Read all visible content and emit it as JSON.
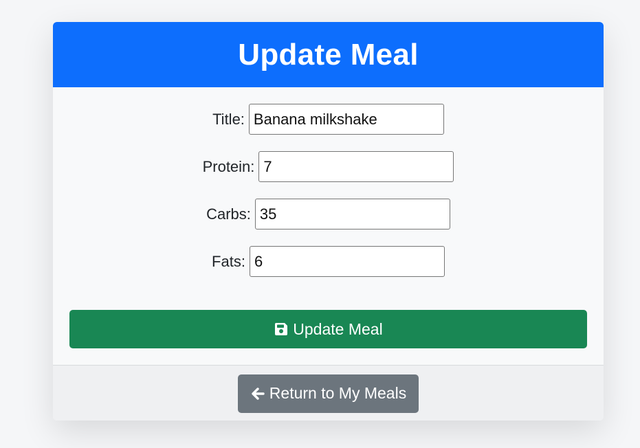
{
  "header": {
    "title": "Update Meal",
    "color": "#0d6efd"
  },
  "form": {
    "fields": [
      {
        "label": "Title:",
        "value": "Banana milkshake"
      },
      {
        "label": "Protein:",
        "value": "7"
      },
      {
        "label": "Carbs:",
        "value": "35"
      },
      {
        "label": "Fats:",
        "value": "6"
      }
    ],
    "submit_label": "Update Meal",
    "submit_icon": "save-icon",
    "submit_color": "#198754"
  },
  "footer": {
    "return_label": "Return to My Meals",
    "return_icon": "arrow-left-icon",
    "return_color": "#6c757d"
  }
}
